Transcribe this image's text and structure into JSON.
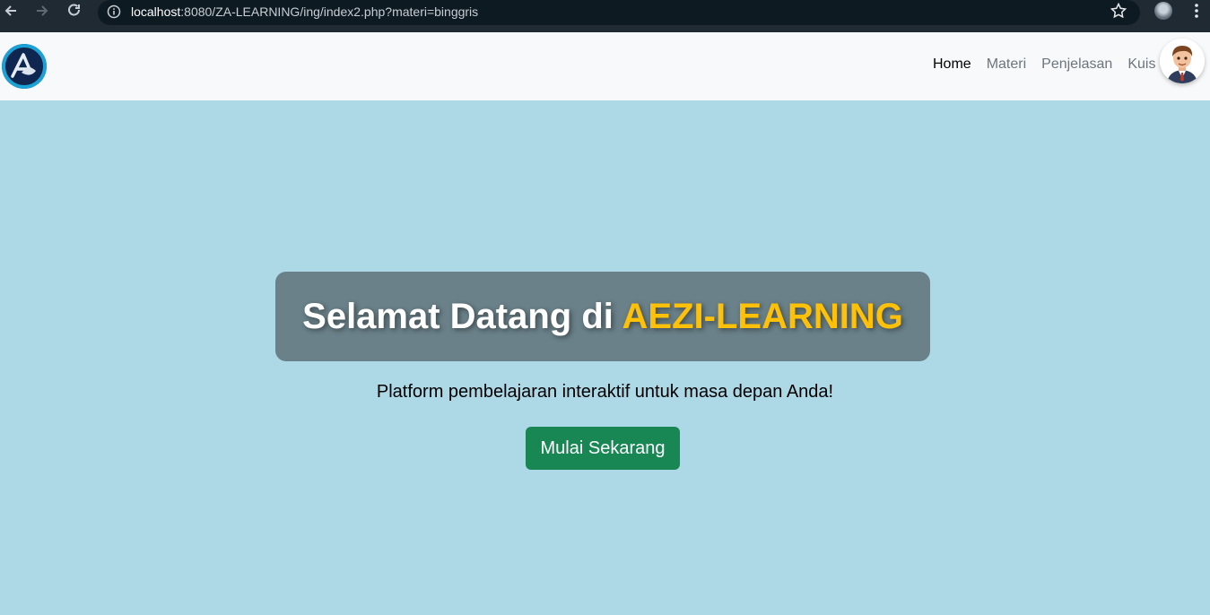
{
  "browser": {
    "url_host": "localhost",
    "url_rest": ":8080/ZA-LEARNING/ing/index2.php?materi=binggris",
    "icons": [
      "back-icon",
      "forward-icon",
      "reload-icon",
      "info-icon",
      "star-icon",
      "profile-icon",
      "kebab-menu-icon"
    ]
  },
  "navbar": {
    "logo_icon": "aezi-logo-icon",
    "links": [
      {
        "label": "Home",
        "active": true
      },
      {
        "label": "Materi",
        "active": false
      },
      {
        "label": "Penjelasan",
        "active": false
      },
      {
        "label": "Kuis",
        "active": false
      }
    ],
    "avatar_icon": "cartoon-avatar-icon"
  },
  "hero": {
    "title_prefix": "Selamat Datang di ",
    "title_brand": "AEZI-LEARNING",
    "subtitle": "Platform pembelajaran interaktif untuk masa depan Anda!",
    "cta_label": "Mulai Sekarang"
  },
  "colors": {
    "page_bg": "#add8e6",
    "navbar_bg": "#f8f9fa",
    "title_box_bg": "#6a8189",
    "brand": "#ffc107",
    "cta_bg": "#198754",
    "browser_bar_bg": "#1f2a33"
  }
}
